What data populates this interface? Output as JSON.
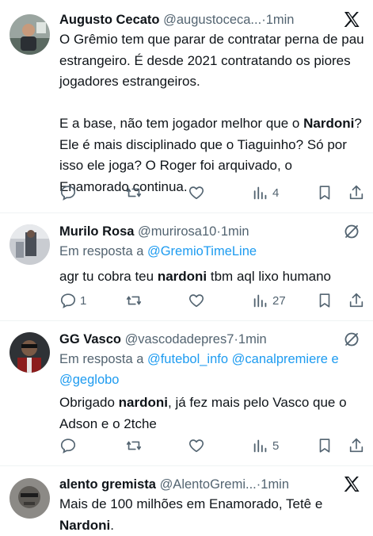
{
  "tweets": [
    {
      "name": "Augusto Cecato",
      "handle": "@augustoceca...",
      "time": "1min",
      "platform_icon": "x-logo-icon",
      "body_lines": [
        [
          "O Grêmio tem que parar de contratar perna de pau estrangeiro. É desde 2021 contratando os piores jogadores estrangeiros."
        ],
        [
          "E a base, não tem jogador melhor que o ",
          {
            "b": "Nardoni"
          },
          "? Ele é mais disciplinado que o Tiaguinho? Só por isso ele joga? O Roger foi arquivado, o Enamorado continua."
        ]
      ],
      "actions": {
        "reply": "",
        "retweet": "",
        "like": "",
        "views": "4"
      }
    },
    {
      "name": "Murilo Rosa",
      "handle": "@murirosa10",
      "time": "1min",
      "platform_icon": "bluesky-like-icon",
      "reply_prefix": "Em resposta a ",
      "reply_links": [
        "@GremioTimeLine"
      ],
      "body_lines": [
        [
          "agr tu cobra teu ",
          {
            "b": "nardoni"
          },
          " tbm aql lixo humano"
        ]
      ],
      "actions": {
        "reply": "1",
        "retweet": "",
        "like": "",
        "views": "27"
      }
    },
    {
      "name": "GG Vasco",
      "handle": "@vascodadepres7",
      "time": "1min",
      "platform_icon": "bluesky-like-icon",
      "reply_prefix": "Em resposta a ",
      "reply_links": [
        "@futebol_info",
        "@canalpremiere",
        "e",
        "@geglobo"
      ],
      "body_lines": [
        [
          "Obrigado ",
          {
            "b": "nardoni"
          },
          ", já fez mais pelo Vasco que o Adson e o 2tche"
        ]
      ],
      "actions": {
        "reply": "",
        "retweet": "",
        "like": "",
        "views": "5"
      }
    },
    {
      "name": "alento gremista",
      "handle": "@AlentoGremi...",
      "time": "1min",
      "platform_icon": "x-logo-icon",
      "body_lines": [
        [
          "Mais de 100 milhões em Enamorado, Tetê e ",
          {
            "b": "Nardoni"
          },
          "."
        ]
      ]
    }
  ],
  "separator": "·"
}
